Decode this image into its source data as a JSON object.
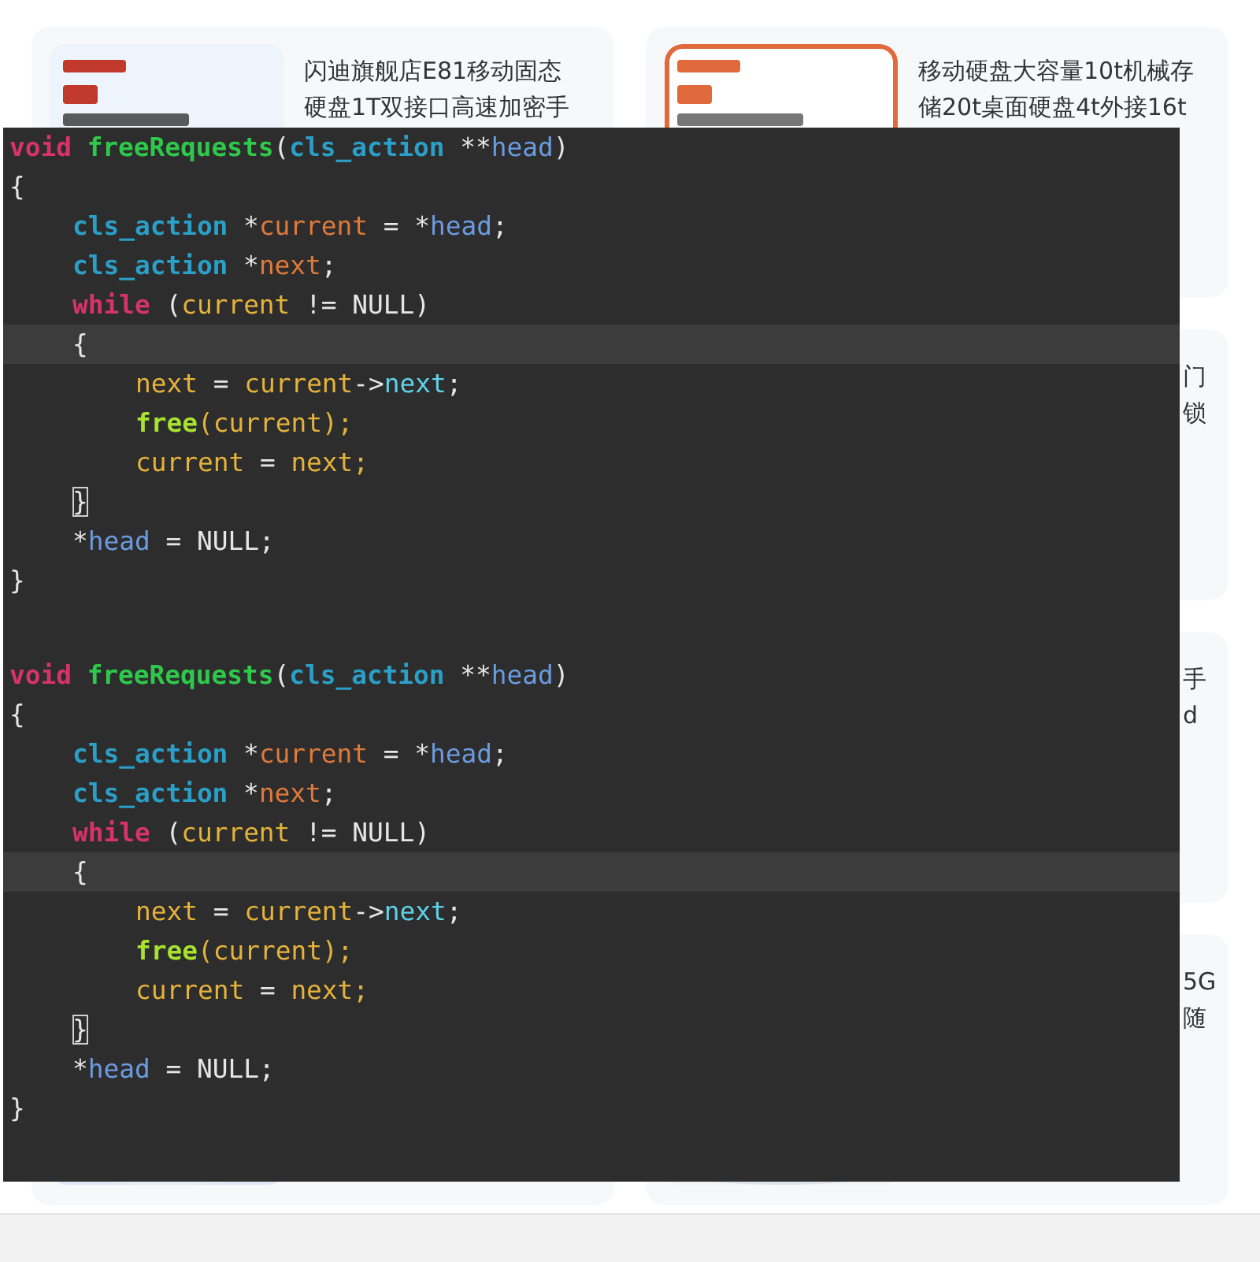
{
  "cards": [
    {
      "kind": "full",
      "image": {
        "kind": "picture"
      },
      "title_lines": [
        "闪迪旗舰店E81移动固态",
        "硬盘1T双接口高速加密手"
      ]
    },
    {
      "kind": "full",
      "image": {
        "kind": "picture"
      },
      "title_lines": [
        "移动硬盘大容量10t机械存",
        "储20t桌面硬盘4t外接16t"
      ]
    },
    {
      "kind": "covered",
      "title_fragments": [
        "门",
        "锁"
      ]
    },
    {
      "kind": "covered",
      "title_fragments": [
        "手",
        "d"
      ]
    },
    {
      "kind": "covered",
      "image": {
        "kind": "picture"
      }
    },
    {
      "kind": "covered",
      "image": {
        "kind": "picture"
      },
      "title_fragments": [
        "5G",
        "随"
      ]
    }
  ],
  "code_blocks": [
    {
      "lines": [
        {
          "kind": "top",
          "highlighted": false,
          "tokens": [
            {
              "text": "void",
              "kind": "keyword"
            },
            {
              "text": "freeRequests",
              "kind": "function",
              "gap": true
            },
            {
              "text": "(",
              "kind": "plain"
            },
            {
              "text": "cls_action",
              "kind": "type"
            },
            {
              "text": " **",
              "kind": "plain"
            },
            {
              "text": "head",
              "kind": "param"
            },
            {
              "text": ")",
              "kind": "plain"
            }
          ]
        },
        {
          "kind": "top",
          "highlighted": false,
          "tokens": [
            {
              "text": "{",
              "kind": "plain"
            }
          ]
        },
        {
          "kind": "block",
          "highlighted": false,
          "tokens": [
            {
              "text": "cls_action",
              "kind": "type"
            },
            {
              "text": " *",
              "kind": "plain"
            },
            {
              "text": "current",
              "kind": "local"
            },
            {
              "text": " = *",
              "kind": "plain"
            },
            {
              "text": "head",
              "kind": "param"
            },
            {
              "text": ";",
              "kind": "plain"
            }
          ]
        },
        {
          "kind": "block",
          "highlighted": false,
          "tokens": [
            {
              "text": "cls_action",
              "kind": "type"
            },
            {
              "text": " *",
              "kind": "plain"
            },
            {
              "text": "next",
              "kind": "local"
            },
            {
              "text": ";",
              "kind": "plain"
            }
          ]
        },
        {
          "kind": "block",
          "highlighted": false,
          "tokens": [
            {
              "text": "while",
              "kind": "keyword"
            },
            {
              "text": " (",
              "kind": "plain"
            },
            {
              "text": "current",
              "kind": "variable"
            },
            {
              "text": " != NULL)",
              "kind": "plain"
            }
          ]
        },
        {
          "kind": "block",
          "highlighted": true,
          "tokens": [
            {
              "text": "{",
              "kind": "plain"
            }
          ]
        },
        {
          "kind": "nested",
          "highlighted": false,
          "tokens": [
            {
              "text": "next",
              "kind": "variable"
            },
            {
              "text": " = ",
              "kind": "plain"
            },
            {
              "text": "current",
              "kind": "variable"
            },
            {
              "text": "->",
              "kind": "plain"
            },
            {
              "text": "next",
              "kind": "field"
            },
            {
              "text": ";",
              "kind": "plain"
            }
          ]
        },
        {
          "kind": "nested",
          "highlighted": false,
          "tokens": [
            {
              "text": "free",
              "kind": "builtin"
            },
            {
              "text": "(",
              "kind": "variable"
            },
            {
              "text": "current",
              "kind": "variable"
            },
            {
              "text": ");",
              "kind": "variable"
            }
          ]
        },
        {
          "kind": "nested",
          "highlighted": false,
          "tokens": [
            {
              "text": "current",
              "kind": "variable"
            },
            {
              "text": " = ",
              "kind": "plain"
            },
            {
              "text": "next",
              "kind": "variable"
            },
            {
              "text": ";",
              "kind": "variable"
            }
          ]
        },
        {
          "kind": "block",
          "highlighted": false,
          "tokens": [
            {
              "text": "}",
              "kind": "plain",
              "cursor": true
            }
          ]
        },
        {
          "kind": "block",
          "highlighted": false,
          "tokens": [
            {
              "text": "*",
              "kind": "plain"
            },
            {
              "text": "head",
              "kind": "param"
            },
            {
              "text": " = NULL;",
              "kind": "plain"
            }
          ]
        },
        {
          "kind": "top",
          "highlighted": false,
          "tokens": [
            {
              "text": "}",
              "kind": "plain"
            }
          ]
        }
      ]
    },
    {
      "lines": [
        {
          "kind": "top",
          "highlighted": false,
          "tokens": [
            {
              "text": "void",
              "kind": "keyword"
            },
            {
              "text": "freeRequests",
              "kind": "function",
              "gap": true
            },
            {
              "text": "(",
              "kind": "plain"
            },
            {
              "text": "cls_action",
              "kind": "type"
            },
            {
              "text": " **",
              "kind": "plain"
            },
            {
              "text": "head",
              "kind": "param"
            },
            {
              "text": ")",
              "kind": "plain"
            }
          ]
        },
        {
          "kind": "top",
          "highlighted": false,
          "tokens": [
            {
              "text": "{",
              "kind": "plain"
            }
          ]
        },
        {
          "kind": "block",
          "highlighted": false,
          "tokens": [
            {
              "text": "cls_action",
              "kind": "type"
            },
            {
              "text": " *",
              "kind": "plain"
            },
            {
              "text": "current",
              "kind": "local"
            },
            {
              "text": " = *",
              "kind": "plain"
            },
            {
              "text": "head",
              "kind": "param"
            },
            {
              "text": ";",
              "kind": "plain"
            }
          ]
        },
        {
          "kind": "block",
          "highlighted": false,
          "tokens": [
            {
              "text": "cls_action",
              "kind": "type"
            },
            {
              "text": " *",
              "kind": "plain"
            },
            {
              "text": "next",
              "kind": "local"
            },
            {
              "text": ";",
              "kind": "plain"
            }
          ]
        },
        {
          "kind": "block",
          "highlighted": false,
          "tokens": [
            {
              "text": "while",
              "kind": "keyword"
            },
            {
              "text": " (",
              "kind": "plain"
            },
            {
              "text": "current",
              "kind": "variable"
            },
            {
              "text": " != NULL)",
              "kind": "plain"
            }
          ]
        },
        {
          "kind": "block",
          "highlighted": true,
          "tokens": [
            {
              "text": "{",
              "kind": "plain"
            }
          ]
        },
        {
          "kind": "nested",
          "highlighted": false,
          "tokens": [
            {
              "text": "next",
              "kind": "variable"
            },
            {
              "text": " = ",
              "kind": "plain"
            },
            {
              "text": "current",
              "kind": "variable"
            },
            {
              "text": "->",
              "kind": "plain"
            },
            {
              "text": "next",
              "kind": "field"
            },
            {
              "text": ";",
              "kind": "plain"
            }
          ]
        },
        {
          "kind": "nested",
          "highlighted": false,
          "tokens": [
            {
              "text": "free",
              "kind": "builtin"
            },
            {
              "text": "(",
              "kind": "variable"
            },
            {
              "text": "current",
              "kind": "variable"
            },
            {
              "text": ");",
              "kind": "variable"
            }
          ]
        },
        {
          "kind": "nested",
          "highlighted": false,
          "tokens": [
            {
              "text": "current",
              "kind": "variable"
            },
            {
              "text": " = ",
              "kind": "plain"
            },
            {
              "text": "next",
              "kind": "variable"
            },
            {
              "text": ";",
              "kind": "variable"
            }
          ]
        },
        {
          "kind": "block",
          "highlighted": false,
          "tokens": [
            {
              "text": "}",
              "kind": "plain",
              "cursor": true
            }
          ]
        },
        {
          "kind": "block",
          "highlighted": false,
          "tokens": [
            {
              "text": "*",
              "kind": "plain"
            },
            {
              "text": "head",
              "kind": "param"
            },
            {
              "text": " = NULL;",
              "kind": "plain"
            }
          ]
        },
        {
          "kind": "top",
          "highlighted": false,
          "tokens": [
            {
              "text": "}",
              "kind": "plain"
            }
          ]
        }
      ]
    }
  ]
}
